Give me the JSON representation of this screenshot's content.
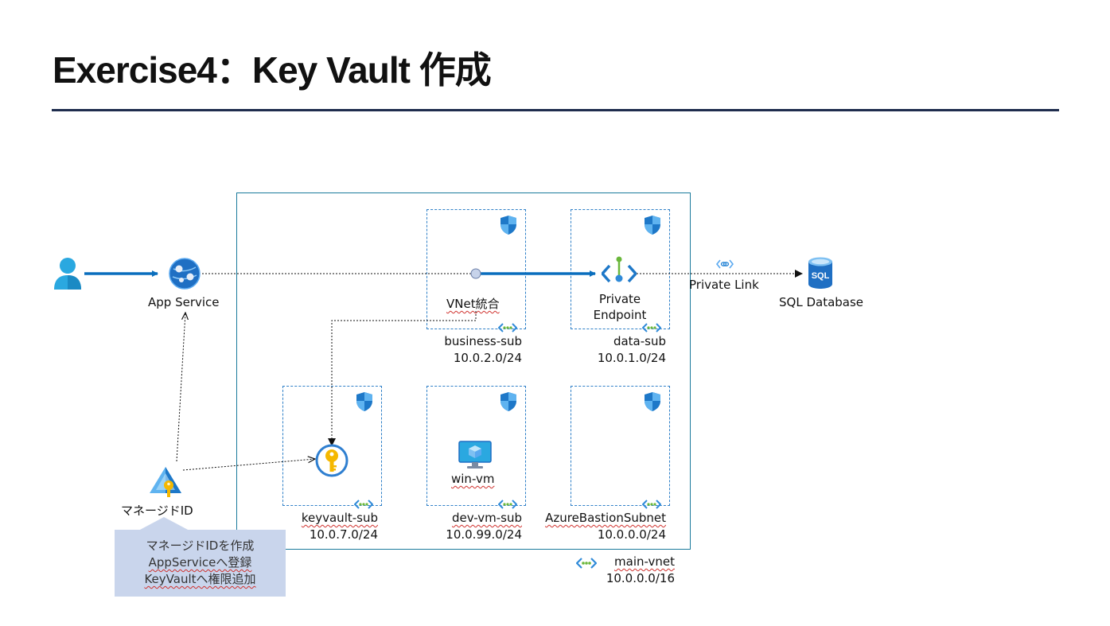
{
  "title": "Exercise4：Key Vault 作成",
  "colors": {
    "accent": "#0a6ebd",
    "rule": "#1f2d4e",
    "vnet_border": "#1a7a9c",
    "note_bg": "#c9d5ec"
  },
  "nodes": {
    "user": {
      "icon": "user-icon"
    },
    "app_service": {
      "label": "App Service",
      "icon": "app-service-icon"
    },
    "vnet_integration": {
      "label": "VNet統合"
    },
    "private_endpoint": {
      "line1": "Private",
      "line2": "Endpoint",
      "icon": "private-endpoint-icon"
    },
    "private_link": {
      "label": "Private Link",
      "icon": "private-link-icon"
    },
    "sql_database": {
      "label": "SQL Database",
      "icon": "sql-database-icon",
      "badge": "SQL"
    },
    "key_vault": {
      "icon": "key-vault-icon"
    },
    "win_vm": {
      "label": "win-vm",
      "icon": "virtual-machine-icon"
    },
    "managed_id": {
      "label": "マネージドID",
      "icon": "managed-identity-icon"
    }
  },
  "subnets": {
    "business": {
      "name": "business-sub",
      "cidr": "10.0.2.0/24"
    },
    "data": {
      "name": "data-sub",
      "cidr": "10.0.1.0/24"
    },
    "keyvault": {
      "name": "keyvault-sub",
      "cidr": "10.0.7.0/24"
    },
    "devvm": {
      "name": "dev-vm-sub",
      "cidr": "10.0.99.0/24"
    },
    "bastion": {
      "name": "AzureBastionSubnet",
      "cidr": "10.0.0.0/24"
    }
  },
  "vnet": {
    "name": "main-vnet",
    "cidr": "10.0.0.0/16",
    "icon": "vnet-icon"
  },
  "note": {
    "line1": "マネージドIDを作成",
    "line2": "AppServiceへ登録",
    "line3": "KeyVaultへ権限追加"
  }
}
